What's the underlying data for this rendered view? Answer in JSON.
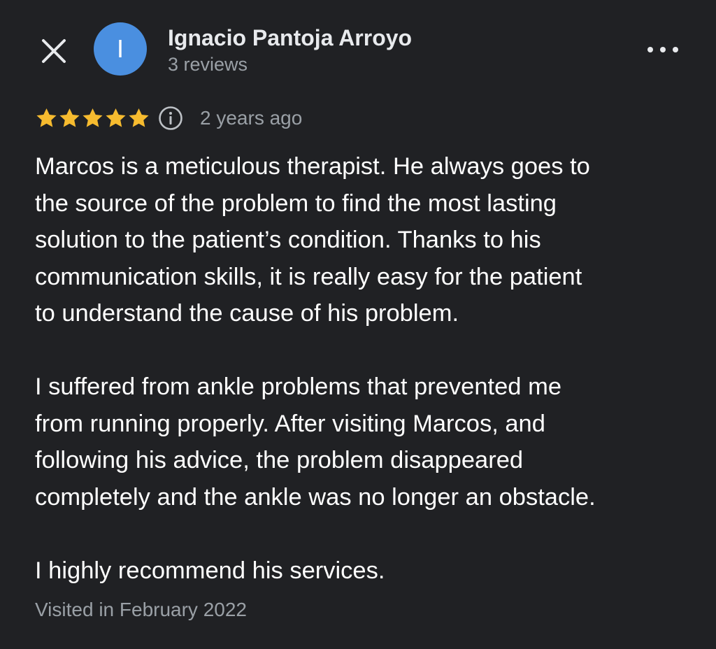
{
  "header": {
    "close_icon": "close-icon",
    "avatar_initial": "I",
    "avatar_color": "#4a8fe0",
    "author_name": "Ignacio Pantoja Arroyo",
    "review_count": "3 reviews",
    "more_icon": "more-horizontal-icon"
  },
  "review": {
    "rating": 5,
    "rating_max": 5,
    "star_color": "#f6bb2f",
    "info_icon": "info-icon",
    "time_ago": "2 years ago",
    "paragraphs": [
      "Marcos is a meticulous therapist. He always goes to\nthe source of the problem to find the most lasting\nsolution to the patient’s condition. Thanks to his\ncommunication skills, it is really easy for the patient\nto understand the cause of his problem.",
      "I suffered from ankle problems that prevented me\nfrom running properly. After visiting Marcos, and\nfollowing his advice, the problem disappeared\ncompletely and the ankle was no longer an obstacle.",
      "I highly recommend his services."
    ],
    "visited": "Visited in February 2022"
  },
  "colors": {
    "background": "#202124",
    "primary_text": "#e8eaed",
    "secondary_text": "#9aa0a6"
  }
}
